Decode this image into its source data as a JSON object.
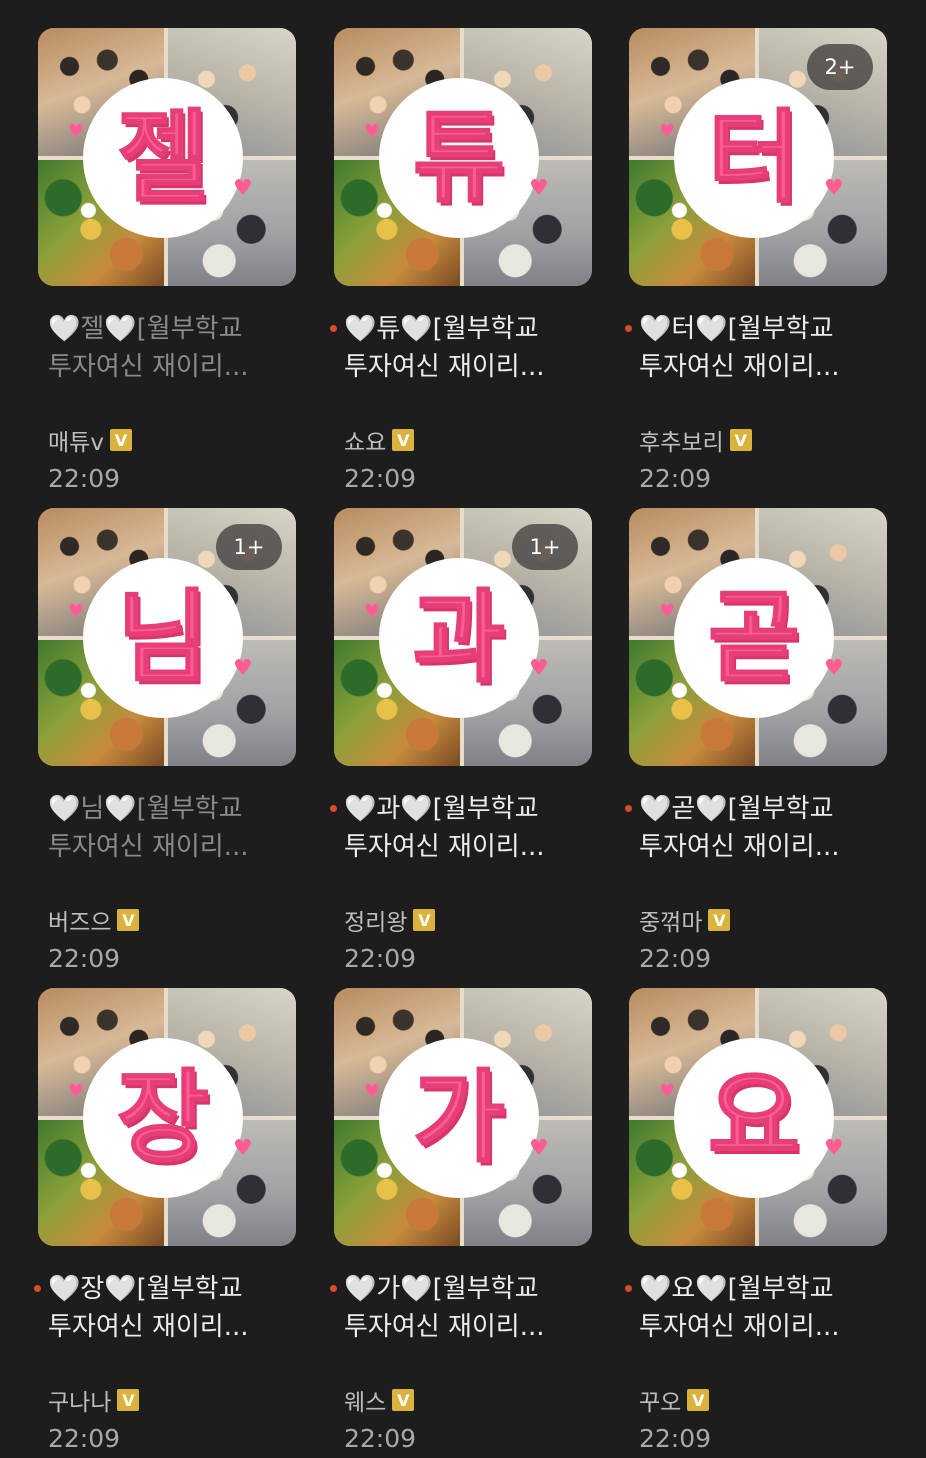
{
  "colors": {
    "background": "#1d1d1d",
    "accent_pink": "#ff5c93",
    "unread_dot": "#d94a2f",
    "verified_badge": "#d9b33b"
  },
  "items": [
    {
      "char": "젤",
      "title": "🤍젤🤍[월부학교 투자여신 재이리...",
      "author": "매튜v",
      "verified": "V",
      "time": "22:09",
      "unread": false,
      "count": ""
    },
    {
      "char": "튜",
      "title": "🤍튜🤍[월부학교 투자여신 재이리...",
      "author": "쇼요",
      "verified": "V",
      "time": "22:09",
      "unread": true,
      "count": ""
    },
    {
      "char": "터",
      "title": "🤍터🤍[월부학교 투자여신 재이리...",
      "author": "후추보리",
      "verified": "V",
      "time": "22:09",
      "unread": true,
      "count": "2+"
    },
    {
      "char": "님",
      "title": "🤍님🤍[월부학교 투자여신 재이리...",
      "author": "버즈으",
      "verified": "V",
      "time": "22:09",
      "unread": false,
      "count": "1+"
    },
    {
      "char": "과",
      "title": "🤍과🤍[월부학교 투자여신 재이리...",
      "author": "정리왕",
      "verified": "V",
      "time": "22:09",
      "unread": true,
      "count": "1+"
    },
    {
      "char": "곧",
      "title": "🤍곧🤍[월부학교 투자여신 재이리...",
      "author": "중꺾마",
      "verified": "V",
      "time": "22:09",
      "unread": true,
      "count": ""
    },
    {
      "char": "장",
      "title": "🤍장🤍[월부학교 투자여신 재이리...",
      "author": "구나나",
      "verified": "V",
      "time": "22:09",
      "unread": true,
      "count": ""
    },
    {
      "char": "가",
      "title": "🤍가🤍[월부학교 투자여신 재이리...",
      "author": "웨스",
      "verified": "V",
      "time": "22:09",
      "unread": true,
      "count": ""
    },
    {
      "char": "요",
      "title": "🤍요🤍[월부학교 투자여신 재이리...",
      "author": "꾸오",
      "verified": "V",
      "time": "22:09",
      "unread": true,
      "count": ""
    }
  ]
}
